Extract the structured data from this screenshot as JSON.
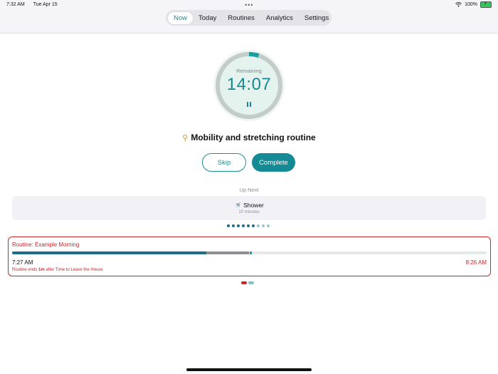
{
  "status": {
    "time": "7:32 AM",
    "date": "Tue Apr 15",
    "dots": "•••",
    "battery": "100%"
  },
  "tabs": [
    {
      "label": "Now",
      "active": true
    },
    {
      "label": "Today",
      "active": false
    },
    {
      "label": "Routines",
      "active": false
    },
    {
      "label": "Analytics",
      "active": false
    },
    {
      "label": "Settings",
      "active": false
    }
  ],
  "timer": {
    "label": "Remaining",
    "time": "14:07",
    "progress": 0.05
  },
  "current_task": {
    "icon": "⚲",
    "title": "Mobility and stretching routine"
  },
  "actions": {
    "skip_label": "Skip",
    "complete_label": "Complete"
  },
  "up_next": {
    "label": "Up Next",
    "icon": "🚿",
    "name": "Shower",
    "duration": "10 minutes"
  },
  "task_pages": {
    "total": 9,
    "dark_count": 6
  },
  "routine": {
    "title": "Routine: Example Morning",
    "start": "7:27 AM",
    "end": "8:26 AM",
    "note_prefix": "Routine ends ",
    "note_bold": "1m",
    "note_suffix": " after Time to Leave the House",
    "elapsed_fraction": 0.41,
    "planned_fraction": 0.5
  },
  "colors": {
    "accent": "#148a94",
    "alert": "#c8272c",
    "progress_dark": "#1a6e87",
    "progress_gray": "#8e8e93"
  },
  "card_pages": [
    {
      "color": "#c8272c"
    },
    {
      "color": "#7fc4c4"
    }
  ]
}
